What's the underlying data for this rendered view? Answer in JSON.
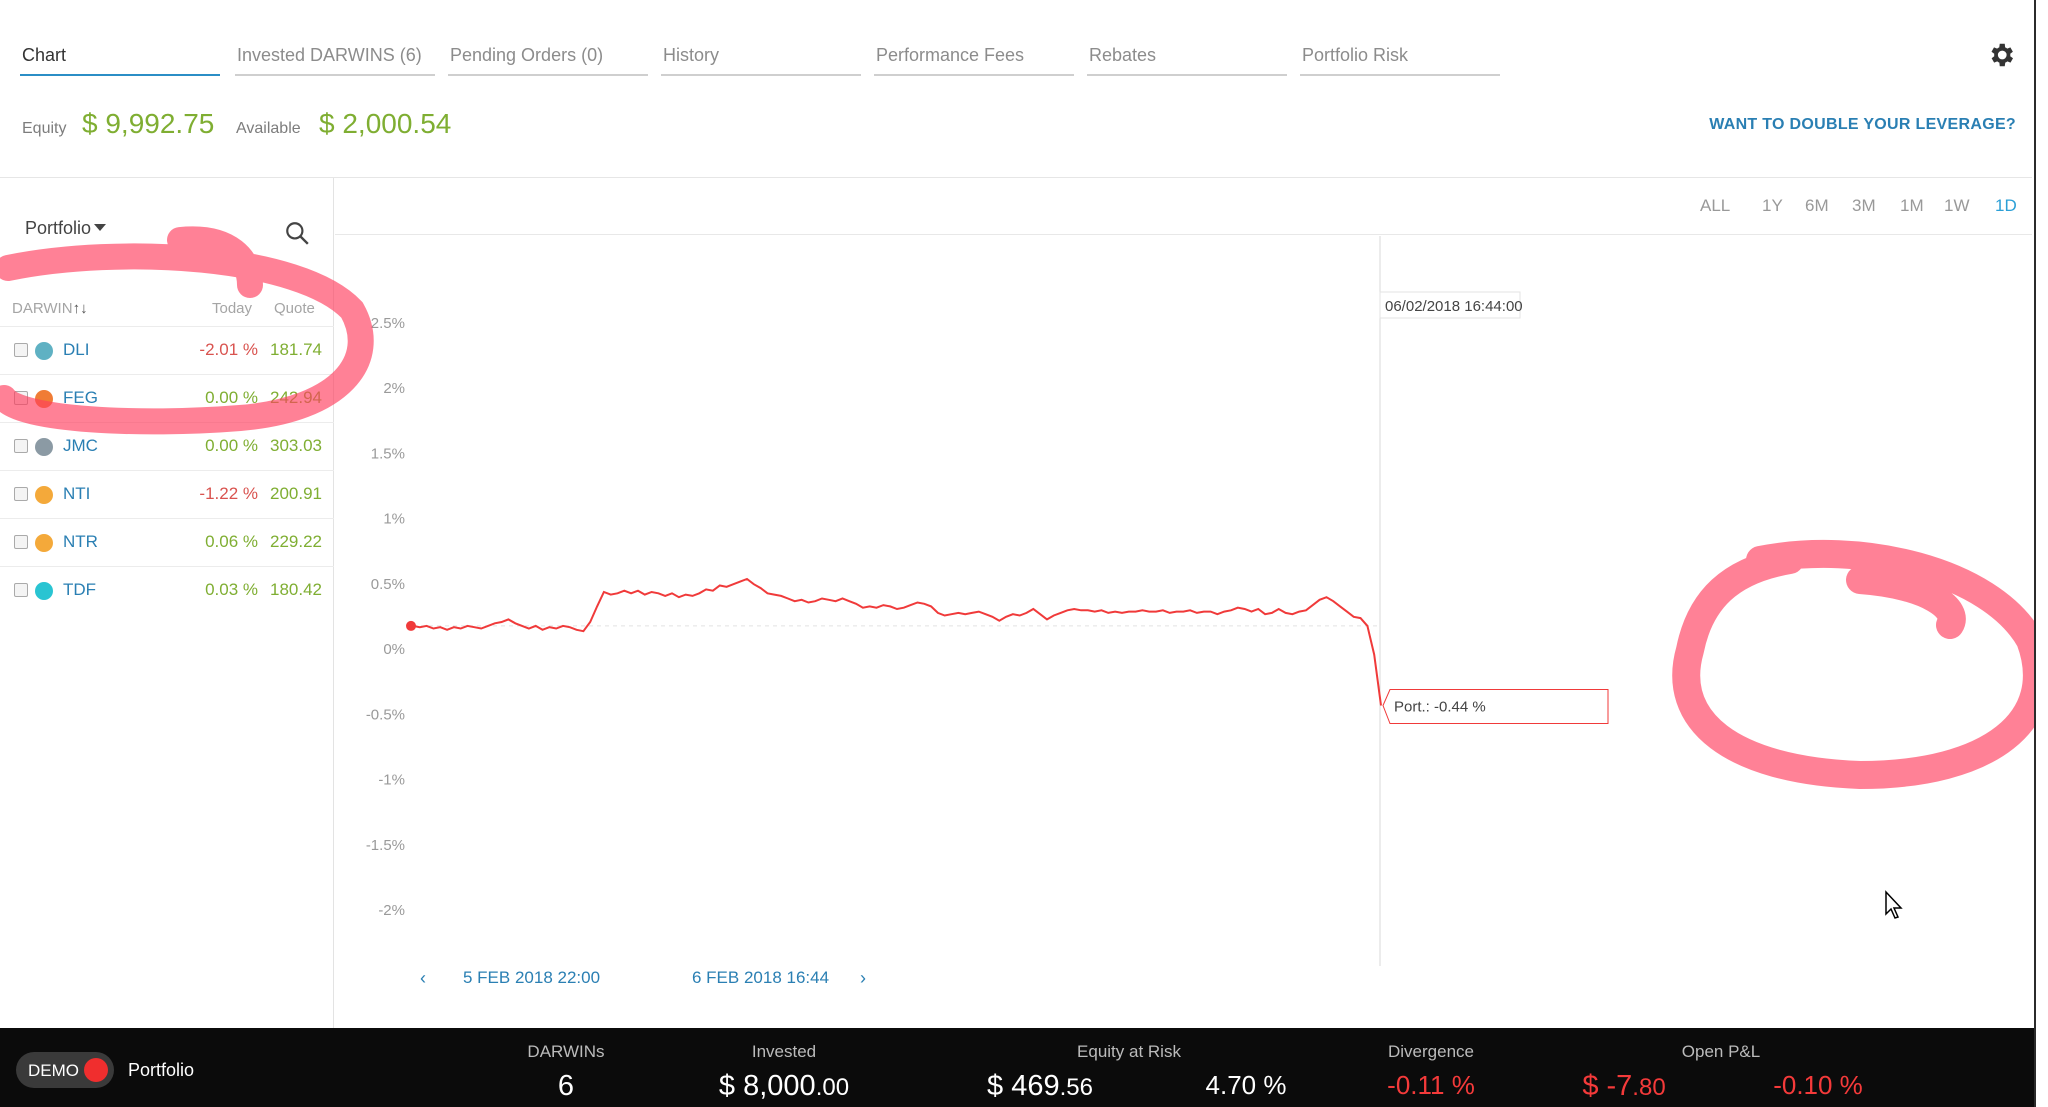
{
  "tabs": [
    {
      "label": "Chart",
      "active": true
    },
    {
      "label": "Invested DARWINS (6)"
    },
    {
      "label": "Pending Orders (0)"
    },
    {
      "label": "History"
    },
    {
      "label": "Performance Fees"
    },
    {
      "label": "Rebates"
    },
    {
      "label": "Portfolio Risk"
    }
  ],
  "equity": {
    "equity_label": "Equity",
    "equity_value": "$ 9,992.75",
    "available_label": "Available",
    "available_value": "$ 2,000.54",
    "leverage_link": "WANT TO DOUBLE YOUR LEVERAGE?"
  },
  "left_panel": {
    "dropdown_label": "Portfolio",
    "headers": {
      "darwin": "DARWIN",
      "sort": "↑↓",
      "today": "Today",
      "quote": "Quote"
    },
    "rows": [
      {
        "name": "DLI",
        "today": "-2.01 %",
        "quote": "181.74",
        "color": "#5fb1c3",
        "today_color": "#d9534f"
      },
      {
        "name": "FEG",
        "today": "0.00 %",
        "quote": "242.94",
        "color": "#f07c35",
        "today_color": "#7fae32"
      },
      {
        "name": "JMC",
        "today": "0.00 %",
        "quote": "303.03",
        "color": "#8b9aa4",
        "today_color": "#7fae32"
      },
      {
        "name": "NTI",
        "today": "-1.22 %",
        "quote": "200.91",
        "color": "#f4a93a",
        "today_color": "#d9534f"
      },
      {
        "name": "NTR",
        "today": "0.06 %",
        "quote": "229.22",
        "color": "#f4a93a",
        "today_color": "#7fae32"
      },
      {
        "name": "TDF",
        "today": "0.03 %",
        "quote": "180.42",
        "color": "#29c4d2",
        "today_color": "#7fae32"
      }
    ]
  },
  "range_buttons": [
    "ALL",
    "1Y",
    "6M",
    "3M",
    "1M",
    "1W",
    "1D"
  ],
  "active_range": "1D",
  "chart_nav": {
    "prev_icon": "chevron-left-icon",
    "start": "5 FEB 2018 22:00",
    "end": "6 FEB 2018 16:44",
    "next_icon": "chevron-right-icon"
  },
  "chart_data": {
    "type": "line",
    "ylabel_ticks": [
      "2.5%",
      "2%",
      "1.5%",
      "1%",
      "0.5%",
      "0%",
      "-0.5%",
      "-1%",
      "-1.5%",
      "-2%"
    ],
    "ylim": [
      -2,
      2.5
    ],
    "series": [
      {
        "name": "Port.",
        "color": "#f03a3a",
        "values": [
          0.17,
          0.16,
          0.17,
          0.15,
          0.16,
          0.14,
          0.16,
          0.15,
          0.17,
          0.16,
          0.15,
          0.17,
          0.19,
          0.2,
          0.22,
          0.19,
          0.17,
          0.15,
          0.17,
          0.14,
          0.16,
          0.15,
          0.17,
          0.16,
          0.14,
          0.13,
          0.2,
          0.32,
          0.43,
          0.41,
          0.42,
          0.44,
          0.42,
          0.44,
          0.41,
          0.43,
          0.42,
          0.4,
          0.42,
          0.39,
          0.41,
          0.4,
          0.42,
          0.45,
          0.44,
          0.48,
          0.47,
          0.49,
          0.51,
          0.53,
          0.49,
          0.46,
          0.42,
          0.41,
          0.4,
          0.38,
          0.36,
          0.37,
          0.35,
          0.36,
          0.38,
          0.37,
          0.36,
          0.38,
          0.36,
          0.34,
          0.31,
          0.32,
          0.31,
          0.33,
          0.32,
          0.3,
          0.31,
          0.33,
          0.35,
          0.34,
          0.32,
          0.27,
          0.25,
          0.26,
          0.27,
          0.26,
          0.27,
          0.28,
          0.26,
          0.24,
          0.21,
          0.24,
          0.26,
          0.25,
          0.27,
          0.3,
          0.26,
          0.22,
          0.25,
          0.27,
          0.29,
          0.3,
          0.29,
          0.29,
          0.28,
          0.29,
          0.27,
          0.28,
          0.27,
          0.28,
          0.28,
          0.29,
          0.28,
          0.28,
          0.29,
          0.27,
          0.28,
          0.28,
          0.29,
          0.27,
          0.28,
          0.28,
          0.26,
          0.28,
          0.29,
          0.31,
          0.3,
          0.28,
          0.3,
          0.26,
          0.27,
          0.3,
          0.27,
          0.26,
          0.28,
          0.29,
          0.33,
          0.37,
          0.39,
          0.36,
          0.32,
          0.28,
          0.24,
          0.23,
          0.17,
          -0.05,
          -0.44
        ]
      }
    ],
    "tooltip_date": "06/02/2018 16:44:00",
    "tooltip_value": "Port.: -0.44 %",
    "grid": false,
    "baseline": 0.17
  },
  "bottom_bar": {
    "demo_label": "DEMO",
    "portfolio_label": "Portfolio",
    "darwins_label": "DARWINs",
    "darwins_value": "6",
    "invested_label": "Invested",
    "invested_value_main": "$ 8,000",
    "invested_value_dec": ".00",
    "equity_at_risk_label": "Equity at Risk",
    "equity_at_risk_main": "$ 469",
    "equity_at_risk_dec": ".56",
    "equity_at_risk_pct": "4.70 %",
    "divergence_label": "Divergence",
    "divergence_value": "-0.11 %",
    "open_pl_label": "Open P&L",
    "open_pl_value_main": "$ -7",
    "open_pl_value_dec": ".80",
    "open_pl_pct": "-0.10 %"
  }
}
